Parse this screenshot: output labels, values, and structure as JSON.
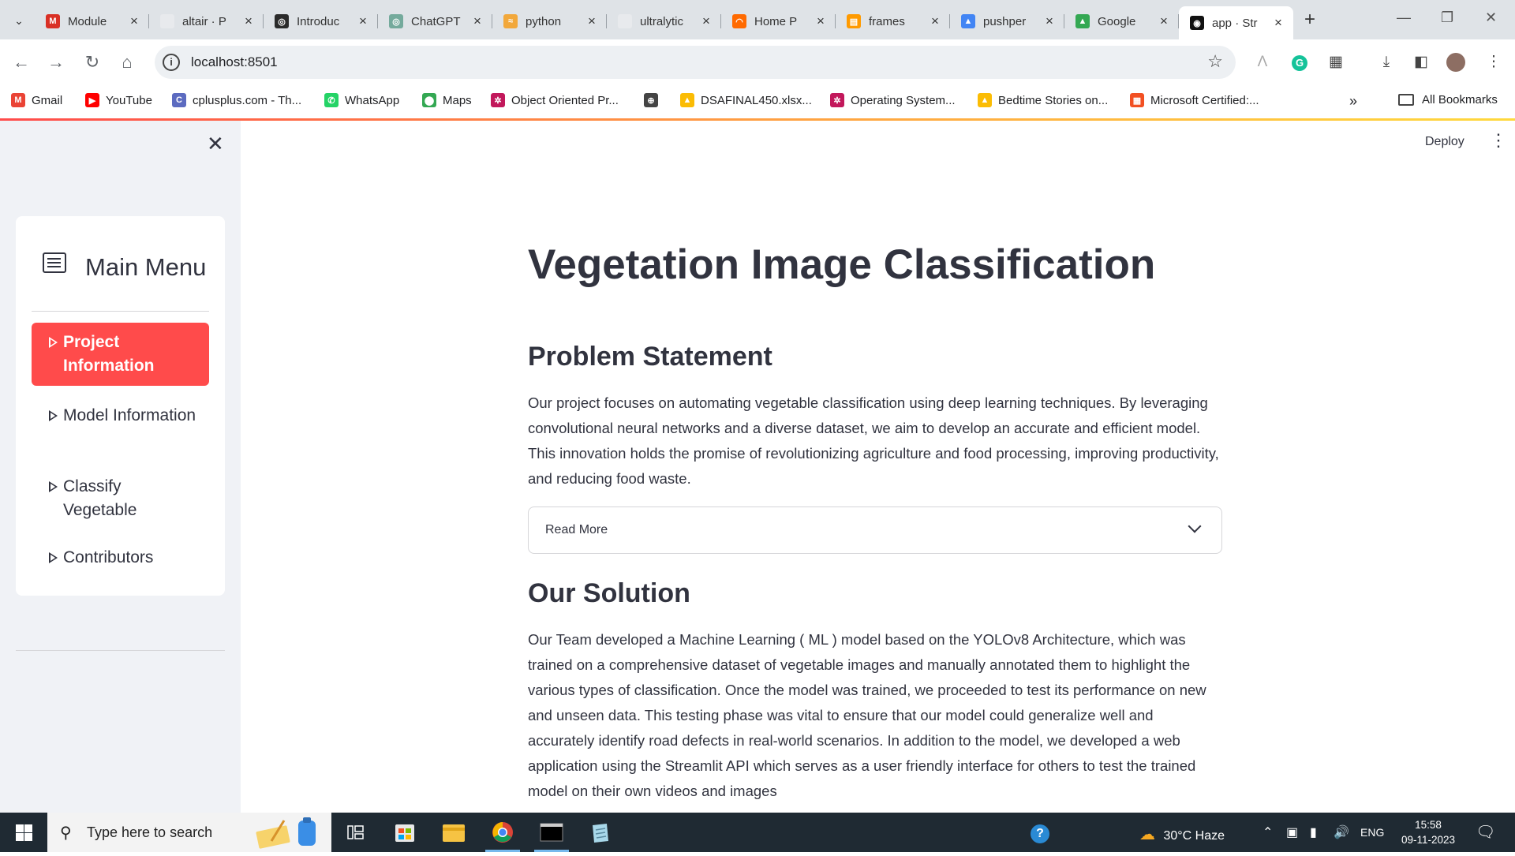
{
  "browser": {
    "tabs": [
      {
        "title": "Module",
        "color": "#d93025",
        "glyph": "M"
      },
      {
        "title": "altair · P",
        "color": "#e8eaed",
        "glyph": ""
      },
      {
        "title": "Introduc",
        "color": "#2b2b2b",
        "glyph": "◎"
      },
      {
        "title": "ChatGPT",
        "color": "#74aa9c",
        "glyph": "◎"
      },
      {
        "title": "python",
        "color": "#f2a83b",
        "glyph": "≈"
      },
      {
        "title": "ultralytic",
        "color": "#e8eaed",
        "glyph": ""
      },
      {
        "title": "Home P",
        "color": "#ff6a00",
        "glyph": "◠"
      },
      {
        "title": "frames",
        "color": "#ff9a00",
        "glyph": "▤"
      },
      {
        "title": "pushper",
        "color": "#4285f4",
        "glyph": "▲"
      },
      {
        "title": "Google",
        "color": "#34a853",
        "glyph": "▲"
      },
      {
        "title": "app · Str",
        "color": "#111",
        "glyph": "◉"
      }
    ],
    "url": "localhost:8501"
  },
  "bookmarks": {
    "items": [
      {
        "label": "Gmail",
        "color": "#ea4335",
        "glyph": "M"
      },
      {
        "label": "YouTube",
        "color": "#ff0000",
        "glyph": "▶"
      },
      {
        "label": "cplusplus.com - Th...",
        "color": "#5c6bc0",
        "glyph": "C"
      },
      {
        "label": "WhatsApp",
        "color": "#25d366",
        "glyph": "✆"
      },
      {
        "label": "Maps",
        "color": "#34a853",
        "glyph": "⬤"
      },
      {
        "label": "Object Oriented Pr...",
        "color": "#c2185b",
        "glyph": "✲"
      },
      {
        "label": "",
        "color": "#444",
        "glyph": "⊕"
      },
      {
        "label": "DSAFINAL450.xlsx...",
        "color": "#fbbc04",
        "glyph": "▲"
      },
      {
        "label": "Operating System...",
        "color": "#c2185b",
        "glyph": "✲"
      },
      {
        "label": "Bedtime Stories on...",
        "color": "#fbbc04",
        "glyph": "▲"
      },
      {
        "label": "Microsoft Certified:...",
        "color": "#f25022",
        "glyph": "▦"
      }
    ],
    "all_bookmarks": "All Bookmarks"
  },
  "app": {
    "deploy_label": "Deploy",
    "sidebar": {
      "menu_title": "Main Menu",
      "items": [
        {
          "label": "Project Information",
          "active": true
        },
        {
          "label": "Model Information",
          "active": false
        },
        {
          "label": "Classify Vegetable",
          "active": false
        },
        {
          "label": "Contributors",
          "active": false
        }
      ]
    },
    "main": {
      "title": "Vegetation Image Classification",
      "problem_heading": "Problem Statement",
      "problem_text": "Our project focuses on automating vegetable classification using deep learning techniques. By leveraging convolutional neural networks and a diverse dataset, we aim to develop an accurate and efficient model. This innovation holds the promise of revolutionizing agriculture and food processing, improving productivity, and reducing food waste.",
      "expander_label": "Read More",
      "solution_heading": "Our Solution",
      "solution_text": "Our Team developed a Machine Learning ( ML ) model based on the YOLOv8 Architecture, which was trained on a comprehensive dataset of vegetable images and manually annotated them to highlight the various types of classification. Once the model was trained, we proceeded to test its performance on new and unseen data. This testing phase was vital to ensure that our model could generalize well and accurately identify road defects in real-world scenarios. In addition to the model, we developed a web application using the Streamlit API which serves as a user friendly interface for others to test the trained model on their own videos and images"
    }
  },
  "taskbar": {
    "search_placeholder": "Type here to search",
    "weather": "30°C Haze",
    "language": "ENG",
    "time": "15:58",
    "date": "09-11-2023"
  }
}
